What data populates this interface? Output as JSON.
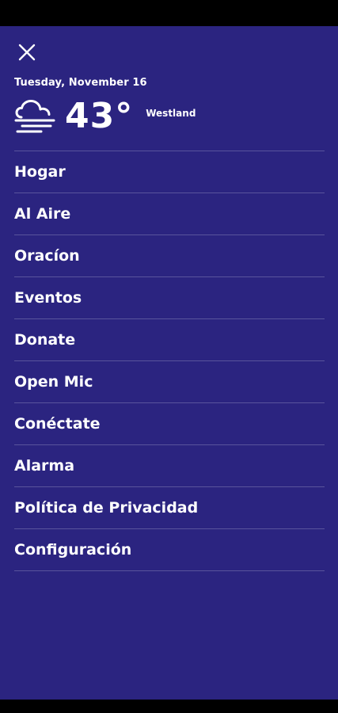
{
  "header": {
    "date": "Tuesday, November 16",
    "temperature": "43°",
    "location": "Westland",
    "weather_icon": "fog-cloud-icon"
  },
  "menu": {
    "items": [
      {
        "label": "Hogar"
      },
      {
        "label": "Al Aire"
      },
      {
        "label": "Oracíon"
      },
      {
        "label": "Eventos"
      },
      {
        "label": "Donate"
      },
      {
        "label": "Open Mic"
      },
      {
        "label": "Conéctate"
      },
      {
        "label": "Alarma"
      },
      {
        "label": "Política de Privacidad"
      },
      {
        "label": "Configuración"
      }
    ]
  },
  "colors": {
    "drawer_background": "#2b2480",
    "text": "#ffffff",
    "divider": "rgba(255,255,255,0.22)"
  }
}
